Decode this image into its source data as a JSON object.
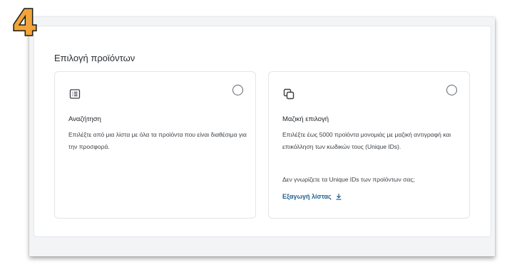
{
  "step_badge": "4",
  "panel": {
    "title": "Επιλογή προϊόντων"
  },
  "cards": {
    "search": {
      "icon": "list-icon",
      "title": "Αναζήτηση",
      "description": "Επιλέξτε από μια λίστα με όλα τα προϊόντα που είναι διαθέσιμα για την προσφορά."
    },
    "bulk": {
      "icon": "copy-icon",
      "title": "Μαζική επιλογή",
      "description": "Επιλέξτε έως 5000 προϊόντα μονομιάς με μαζική αντιγραφή και επικόλληση των κωδικών τους (Unique IDs).",
      "note": "Δεν γνωρίζετε τα Unique IDs των προϊόντων σας;",
      "link_label": "Εξαγωγή λίστας",
      "link_icon": "download-icon"
    }
  },
  "colors": {
    "badge_fill": "#f0a43a",
    "badge_outline": "#1a1a1a",
    "link": "#1f5f8e"
  }
}
